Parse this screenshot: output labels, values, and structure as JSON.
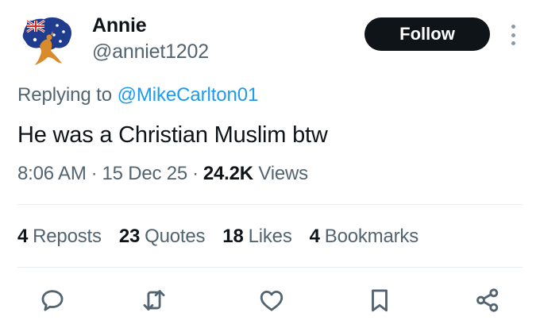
{
  "tweet": {
    "author": {
      "display_name": "Annie",
      "handle": "@anniet1202",
      "avatar": "australian-flag-kangaroo-avatar"
    },
    "follow_label": "Follow",
    "replying_prefix": "Replying to",
    "replying_to": "@MikeCarlton01",
    "text": "He was a Christian Muslim btw",
    "time": "8:06 AM",
    "date": "15 Dec 25",
    "views_count": "24.2K",
    "views_label": "Views",
    "separator": "·"
  },
  "stats": [
    {
      "count": "4",
      "label": "Reposts"
    },
    {
      "count": "23",
      "label": "Quotes"
    },
    {
      "count": "18",
      "label": "Likes"
    },
    {
      "count": "4",
      "label": "Bookmarks"
    }
  ],
  "actions": [
    "reply-icon",
    "repost-icon",
    "like-icon",
    "bookmark-icon",
    "share-icon"
  ],
  "colors": {
    "text_primary": "#0f1419",
    "text_secondary": "#536471",
    "link": "#1d9bf0",
    "follow_bg": "#0f1419",
    "divider": "#e6ecf0",
    "icon": "#536471"
  }
}
